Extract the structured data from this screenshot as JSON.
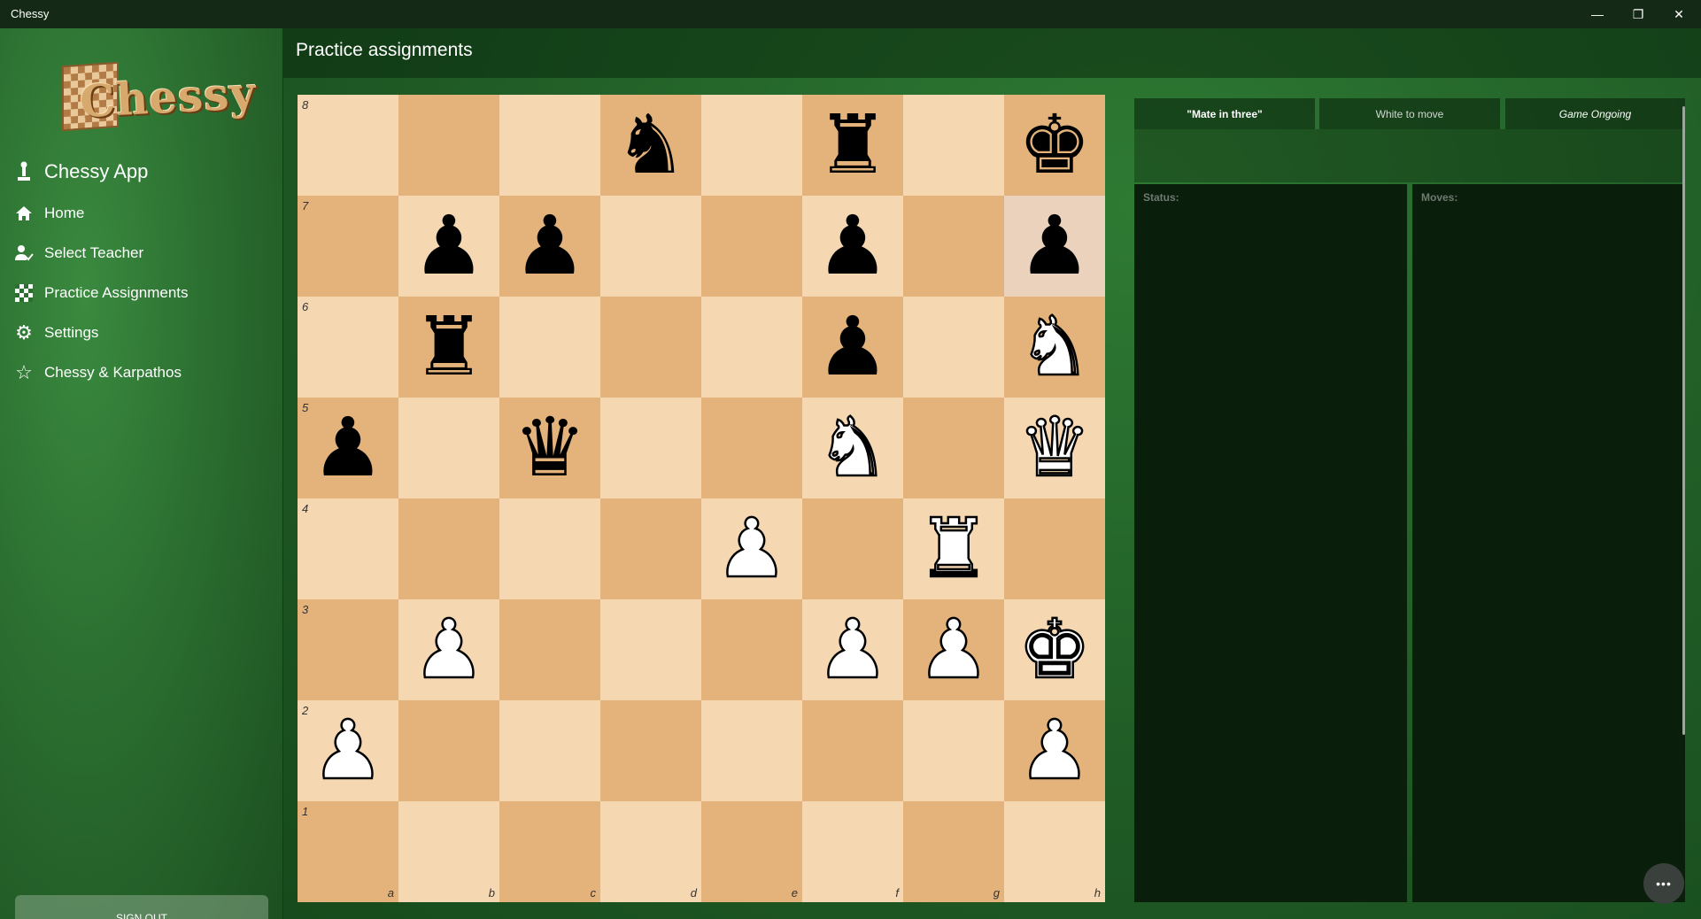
{
  "window": {
    "title": "Chessy",
    "minimize_icon": "—",
    "restore_icon": "❐",
    "close_icon": "✕"
  },
  "sidebar": {
    "logo_text": "Chessy",
    "header": "Chessy App",
    "items": [
      {
        "label": "Home",
        "icon": "home-icon"
      },
      {
        "label": "Select Teacher",
        "icon": "teacher-icon"
      },
      {
        "label": "Practice Assignments",
        "icon": "checkerboard-icon"
      },
      {
        "label": "Settings",
        "icon": "gear-icon"
      },
      {
        "label": "Chessy & Karpathos",
        "icon": "star-icon"
      }
    ],
    "sign_out": "SIGN OUT"
  },
  "page": {
    "title": "Practice assignments"
  },
  "info": {
    "puzzle": "\"Mate in three\"",
    "to_move": "White to move",
    "game_state": "Game Ongoing"
  },
  "panels": {
    "status_title": "Status:",
    "moves_title": "Moves:"
  },
  "more_button": "•••",
  "board": {
    "highlight_squares": [
      "h7"
    ],
    "files": [
      "a",
      "b",
      "c",
      "d",
      "e",
      "f",
      "g",
      "h"
    ],
    "ranks": [
      "8",
      "7",
      "6",
      "5",
      "4",
      "3",
      "2",
      "1"
    ],
    "position": [
      [
        null,
        null,
        null,
        {
          "p": "♞",
          "c": "black",
          "n": "knight"
        },
        null,
        {
          "p": "♜",
          "c": "black",
          "n": "rook"
        },
        null,
        {
          "p": "♚",
          "c": "black",
          "n": "king"
        }
      ],
      [
        null,
        {
          "p": "♟",
          "c": "black",
          "n": "pawn"
        },
        {
          "p": "♟",
          "c": "black",
          "n": "pawn"
        },
        null,
        null,
        {
          "p": "♟",
          "c": "black",
          "n": "pawn"
        },
        null,
        {
          "p": "♟",
          "c": "black",
          "n": "pawn"
        }
      ],
      [
        null,
        {
          "p": "♜",
          "c": "black",
          "n": "rook"
        },
        null,
        null,
        null,
        {
          "p": "♟",
          "c": "black",
          "n": "pawn"
        },
        null,
        {
          "p": "♞",
          "c": "white",
          "n": "knight"
        }
      ],
      [
        {
          "p": "♟",
          "c": "black",
          "n": "pawn"
        },
        null,
        {
          "p": "♛",
          "c": "black",
          "n": "queen"
        },
        null,
        null,
        {
          "p": "♞",
          "c": "white",
          "n": "knight"
        },
        null,
        {
          "p": "♛",
          "c": "white",
          "n": "queen"
        }
      ],
      [
        null,
        null,
        null,
        null,
        {
          "p": "♟",
          "c": "white",
          "n": "pawn"
        },
        null,
        {
          "p": "♜",
          "c": "white",
          "n": "rook"
        },
        null
      ],
      [
        null,
        {
          "p": "♟",
          "c": "white",
          "n": "pawn"
        },
        null,
        null,
        null,
        {
          "p": "♟",
          "c": "white",
          "n": "pawn"
        },
        {
          "p": "♟",
          "c": "white",
          "n": "pawn"
        },
        {
          "p": "♚",
          "c": "white",
          "n": "king"
        }
      ],
      [
        {
          "p": "♟",
          "c": "white",
          "n": "pawn"
        },
        null,
        null,
        null,
        null,
        null,
        null,
        {
          "p": "♟",
          "c": "white",
          "n": "pawn"
        }
      ],
      [
        null,
        null,
        null,
        null,
        null,
        null,
        null,
        null
      ]
    ]
  }
}
